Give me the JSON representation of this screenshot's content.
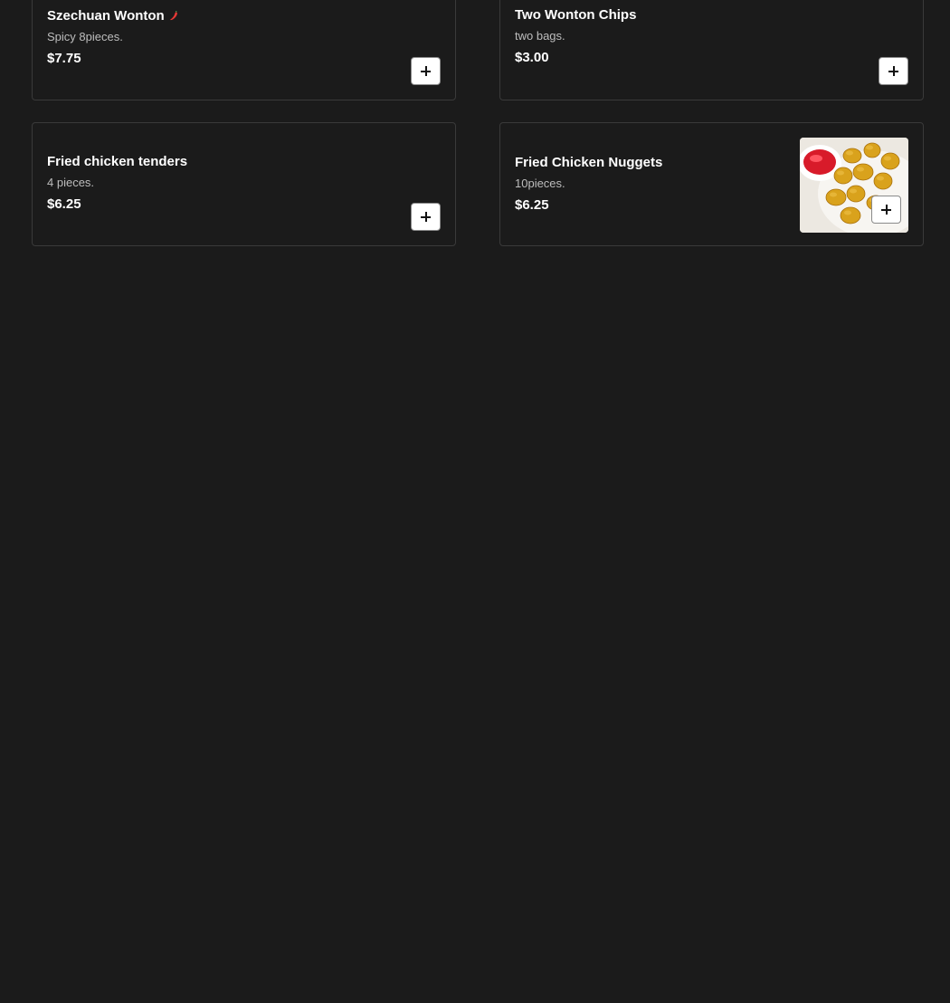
{
  "menu": {
    "items": [
      {
        "name": "Szechuan Wonton",
        "description": "Spicy 8pieces.",
        "price": "$7.75",
        "spicy": true
      },
      {
        "name": "Two Wonton Chips",
        "description": "two bags.",
        "price": "$3.00"
      },
      {
        "name": "Fried chicken tenders",
        "description": "4 pieces.",
        "price": "$6.25"
      },
      {
        "name": "Fried Chicken Nuggets",
        "description": "10pieces.",
        "price": "$6.25",
        "image": "chicken-nuggets-photo"
      }
    ]
  },
  "colors": {
    "background": "#1b1b1b",
    "card_border": "#3a3a3a",
    "spicy": "#e53935"
  },
  "icons": {
    "add": "plus-icon",
    "spicy": "chili-pepper-icon"
  }
}
